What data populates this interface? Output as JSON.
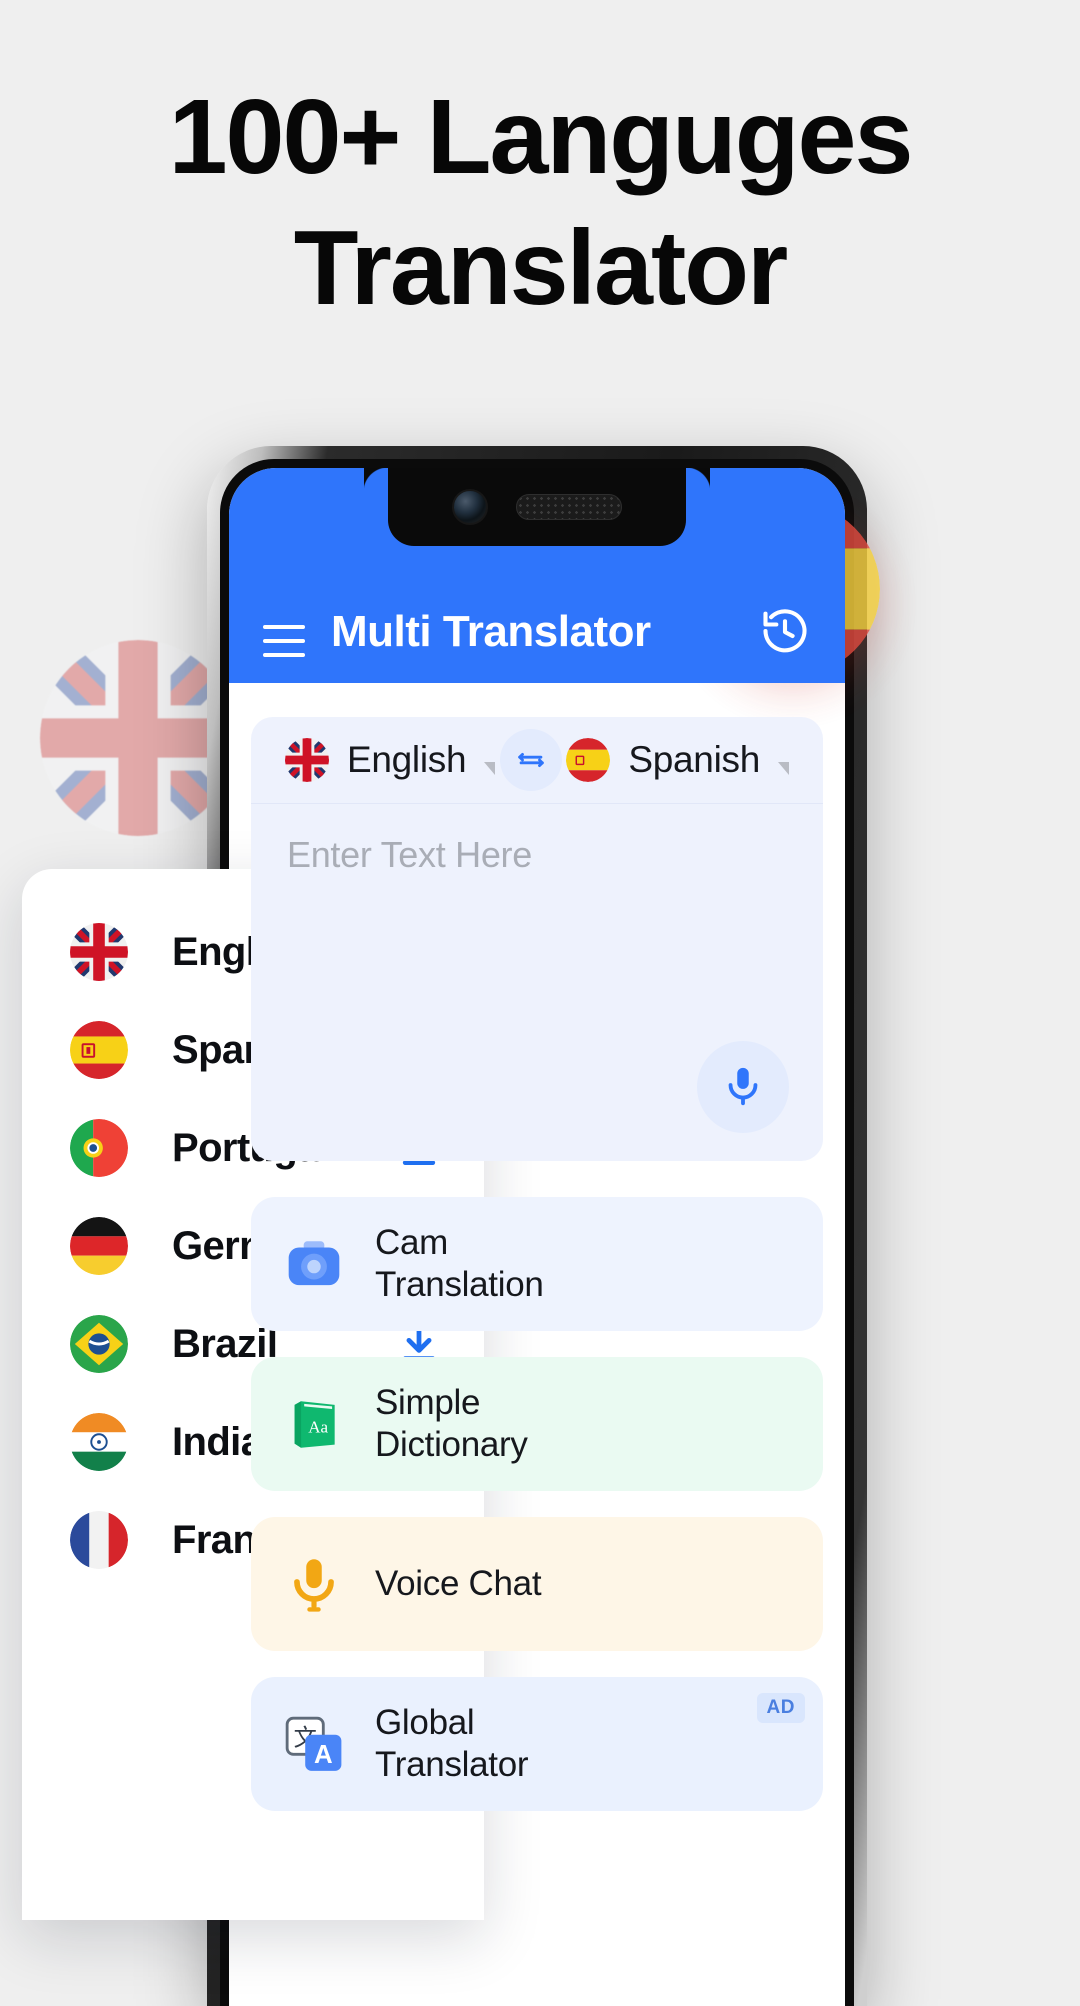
{
  "headline": {
    "line1": "100+ Languges",
    "line2": "Translator"
  },
  "colors": {
    "brand_blue": "#2f75fb",
    "page_bg": "#efefef",
    "check_green": "#1aa85a",
    "download_blue": "#1f6ff0",
    "card_blue_bg": "#eef3fe",
    "card_green_bg": "#eafaf2",
    "card_amber_bg": "#fef6e7",
    "card_ad_bg": "#eaf1fe"
  },
  "phone": {
    "appbar": {
      "menu_icon": "hamburger-menu-icon",
      "title": "Multi Translator",
      "history_icon": "history-clock-icon"
    },
    "language_bar": {
      "source": {
        "label": "English",
        "flag": "flag-uk",
        "caret": "chevron-down-icon"
      },
      "swap_icon": "swap-horizontal-icon",
      "target": {
        "label": "Spanish",
        "flag": "flag-spain",
        "caret": "chevron-down-icon"
      }
    },
    "input_area": {
      "placeholder": "Enter Text Here",
      "value": "",
      "mic_icon": "microphone-icon"
    },
    "feature_cards": [
      {
        "label": "Cam Translation",
        "line1": "Cam",
        "line2": "Translation",
        "icon": "camera-icon",
        "style": "card-blue",
        "badge": ""
      },
      {
        "label": "Simple Dictionary",
        "line1": "Simple",
        "line2": "Dictionary",
        "icon": "book-aa-icon",
        "style": "card-green",
        "badge": ""
      },
      {
        "label": "Voice Chat",
        "line1": "Voice Chat",
        "line2": "",
        "icon": "microphone-gold-icon",
        "style": "card-amber",
        "badge": ""
      },
      {
        "label": "Global Translator",
        "line1": "Global",
        "line2": "Translator",
        "icon": "translate-icon",
        "style": "card-ad",
        "badge": "AD"
      }
    ]
  },
  "dropdown": {
    "items": [
      {
        "name": "English",
        "flag": "flag-uk",
        "action": "check",
        "action_icon": "check-icon"
      },
      {
        "name": "Span",
        "flag": "flag-spain",
        "action": "check",
        "action_icon": "check-icon"
      },
      {
        "name": "Portugal",
        "flag": "flag-portugal",
        "action": "download",
        "action_icon": "download-icon"
      },
      {
        "name": "Germany",
        "flag": "flag-germany",
        "action": "download",
        "action_icon": "download-icon"
      },
      {
        "name": "Brazil",
        "flag": "flag-brazil",
        "action": "download",
        "action_icon": "download-icon"
      },
      {
        "name": "India",
        "flag": "flag-india",
        "action": "download",
        "action_icon": "download-icon"
      },
      {
        "name": "France",
        "flag": "flag-france",
        "action": "download",
        "action_icon": "download-icon"
      }
    ]
  },
  "decorative_flags": [
    {
      "name": "flag-uk",
      "position": "left"
    },
    {
      "name": "flag-spain",
      "position": "right"
    }
  ]
}
